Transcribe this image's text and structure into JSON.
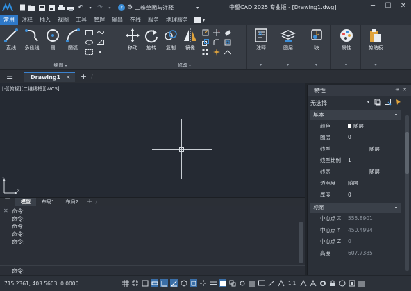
{
  "titlebar": {
    "workspace": "二维草图与注释",
    "window_title": "中望CAD 2025 专业版 - [Drawing1.dwg]"
  },
  "ribbon_tabs": [
    "常用",
    "注释",
    "插入",
    "视图",
    "工具",
    "管理",
    "输出",
    "在线",
    "服务",
    "地理服务"
  ],
  "ribbon": {
    "draw_group": {
      "title": "绘图",
      "tools": [
        "直线",
        "多段线",
        "圆",
        "圆弧"
      ]
    },
    "modify_group": {
      "title": "修改",
      "tools": [
        "移动",
        "旋转",
        "复制",
        "镜像"
      ]
    },
    "annotate_group": {
      "title": "注释"
    },
    "layer_group": {
      "title": "图层"
    },
    "block_group": {
      "title": "块"
    },
    "props_group": {
      "title": "属性"
    },
    "clipboard_group": {
      "title": "剪贴板"
    }
  },
  "document": {
    "tab_name": "Drawing1",
    "view_label": "[-][俯视][二维线框][WCS]"
  },
  "layout_tabs": [
    "模型",
    "布局1",
    "布局2"
  ],
  "command": {
    "history": [
      "命令:",
      "命令:",
      "命令:",
      "命令:",
      "命令:"
    ],
    "prompt": "命令:"
  },
  "properties": {
    "title": "特性",
    "selection": "无选择",
    "basic": {
      "title": "基本",
      "rows": [
        {
          "key": "颜色",
          "value": "随层"
        },
        {
          "key": "图层",
          "value": "0"
        },
        {
          "key": "线型",
          "value": "随层"
        },
        {
          "key": "线型比例",
          "value": "1"
        },
        {
          "key": "线宽",
          "value": "随层"
        },
        {
          "key": "透明度",
          "value": "随层"
        },
        {
          "key": "厚度",
          "value": "0"
        }
      ]
    },
    "view": {
      "title": "视图",
      "rows": [
        {
          "key": "中心点 X",
          "value": "555.8901"
        },
        {
          "key": "中心点 Y",
          "value": "450.4994"
        },
        {
          "key": "中心点 Z",
          "value": "0"
        },
        {
          "key": "高度",
          "value": "607.7385"
        }
      ]
    }
  },
  "statusbar": {
    "coords": "715.2361, 403.5603, 0.0000",
    "scale": "1:1"
  },
  "colors": {
    "accent": "#2e78c7",
    "canvas": "#252a33",
    "panel": "#2b3038"
  }
}
